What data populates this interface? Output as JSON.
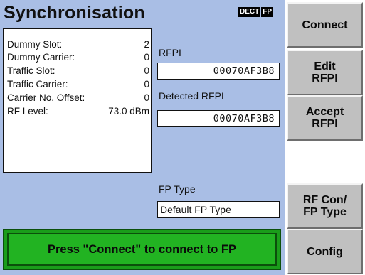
{
  "screen": {
    "title": "Synchronisation",
    "badge_left": "DECT",
    "badge_right": "FP"
  },
  "status": {
    "rows": [
      {
        "label": "Dummy Slot:",
        "value": "2"
      },
      {
        "label": "Dummy Carrier:",
        "value": "0"
      },
      {
        "label": "Traffic Slot:",
        "value": "0"
      },
      {
        "label": "Traffic Carrier:",
        "value": "0"
      },
      {
        "label": "Carrier No. Offset:",
        "value": "0"
      },
      {
        "label": "RF Level:",
        "value": "– 73.0 dBm"
      }
    ]
  },
  "rfpi": {
    "label": "RFPI",
    "value": "00070AF3B8"
  },
  "detected_rfpi": {
    "label": "Detected RFPI",
    "value": "00070AF3B8"
  },
  "fp_type": {
    "label": "FP Type",
    "value": "Default FP Type"
  },
  "message": "Press \"Connect\" to connect to FP",
  "softkeys": {
    "connect": "Connect",
    "edit_rfpi": "Edit\nRFPI",
    "accept_rfpi": "Accept\nRFPI",
    "rf_con_fp_type": "RF Con/\nFP Type",
    "config": "Config"
  },
  "colors": {
    "panel_bg": "#a9bee5",
    "message_bg": "#22b322",
    "softkey_bg": "#c0c0c0"
  }
}
